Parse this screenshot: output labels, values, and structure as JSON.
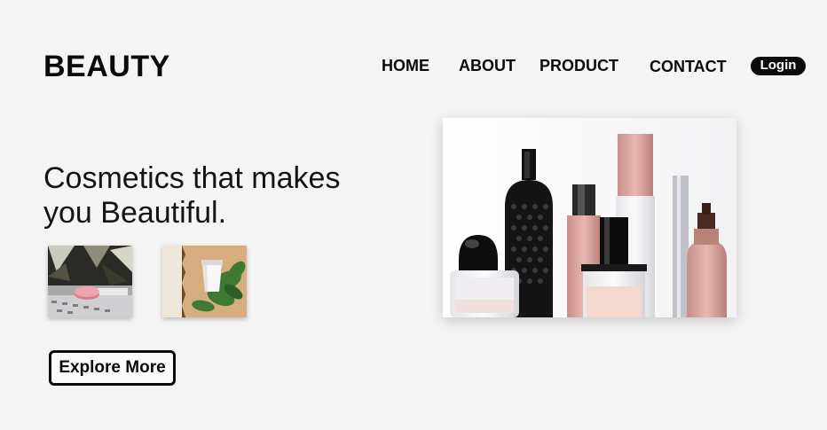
{
  "header": {
    "brand": "BEAUTY",
    "nav": {
      "home": "HOME",
      "about": "ABOUT",
      "product": "PRODUCT",
      "contact": "CONTACT"
    },
    "login_label": "Login"
  },
  "hero": {
    "title_line1": "Cosmetics that makes",
    "title_line2": "you Beautiful.",
    "cta_label": "Explore More"
  },
  "colors": {
    "background": "#f4f4f4",
    "text": "#0a0a0a",
    "login_bg": "#0b0b0b",
    "login_text": "#ffffff"
  },
  "images": {
    "hero": "cosmetics-bottles-photo",
    "thumb_1": "pink-compact-on-tray-photo",
    "thumb_2": "cream-tube-with-leaves-photo"
  }
}
